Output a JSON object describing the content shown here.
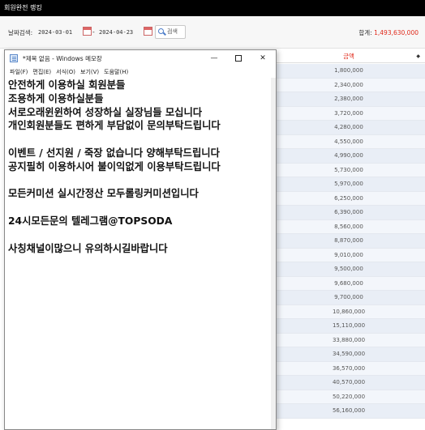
{
  "app": {
    "title": "회원완전 랭킹"
  },
  "filter": {
    "label": "날짜검색:",
    "start_date": "2024-03-01",
    "separator": "-",
    "end_date": "2024-04-23",
    "search_label": "검색",
    "total_label": "합계:",
    "total_amount": "1,493,630,000"
  },
  "table": {
    "header": "금액",
    "sort_icon": "sort-arrows-icon",
    "rows": [
      "1,800,000",
      "2,340,000",
      "2,380,000",
      "3,720,000",
      "4,280,000",
      "4,550,000",
      "4,990,000",
      "5,730,000",
      "5,970,000",
      "6,250,000",
      "6,390,000",
      "8,560,000",
      "8,870,000",
      "9,010,000",
      "9,500,000",
      "9,680,000",
      "9,700,000",
      "10,860,000",
      "15,110,000",
      "33,880,000",
      "34,590,000",
      "36,570,000",
      "40,570,000",
      "50,220,000",
      "56,160,000"
    ]
  },
  "notepad": {
    "title": "*제목 없음 - Windows 메모장",
    "menu": [
      "파일(F)",
      "편집(E)",
      "서식(O)",
      "보기(V)",
      "도움말(H)"
    ],
    "lines": [
      "안전하게 이용하실 회원분들",
      "조용하게 이용하실분들",
      "서로오래윈윈하여 성장하실 실장님들 모십니다",
      "개인회원분들도 편하게 부담없이 문의부탁드립니다",
      "",
      "이벤트 / 선지원 / 죽장 없습니다 양해부탁드립니다",
      "공지필히 이용하시어 불이익없게 이용부탁드립니다",
      "",
      "모든커미션 실시간정산 모두롤링커미션입니다",
      "",
      "24시모든문의 텔레그램@TOPSODA",
      "",
      "사칭채널이많으니 유의하시길바랍니다"
    ]
  },
  "colors": {
    "accent_red": "#e0291a",
    "row_bg": "#e9eef6",
    "topbar_bg": "#000000"
  }
}
